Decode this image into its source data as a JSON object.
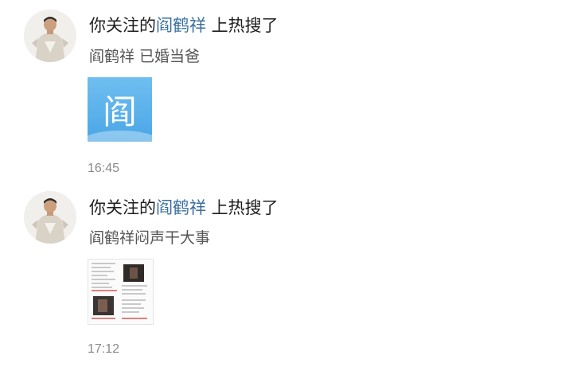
{
  "notifications": [
    {
      "prefix": "你关注的",
      "person": "阎鹤祥",
      "suffix": " 上热搜了",
      "subtitle": "阎鹤祥 已婚当爸",
      "thumb_char": "阎",
      "time": "16:45"
    },
    {
      "prefix": "你关注的",
      "person": "阎鹤祥",
      "suffix": " 上热搜了",
      "subtitle": "阎鹤祥闷声干大事",
      "time": "17:12"
    }
  ],
  "colors": {
    "link": "#3a6f9e",
    "thumb_blue": "#4aa6e6",
    "time_gray": "#8a8a8a"
  }
}
